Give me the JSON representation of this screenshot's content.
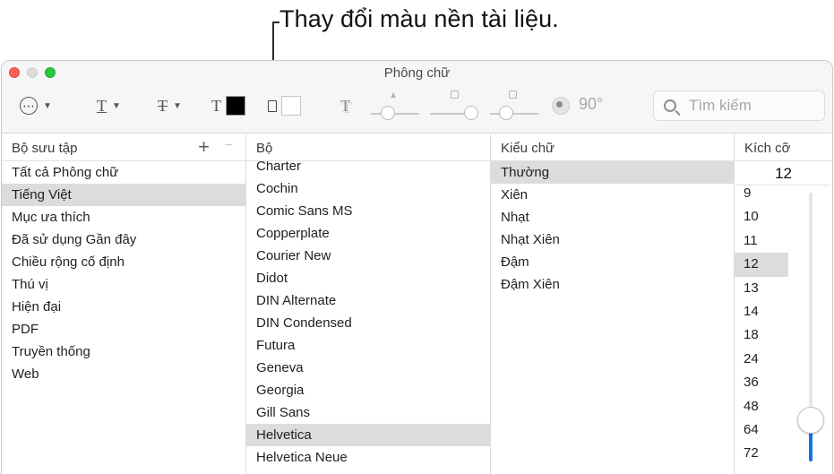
{
  "callout": "Thay đổi màu nền tài liệu.",
  "window": {
    "title": "Phông chữ"
  },
  "toolbar": {
    "action_glyph": "⋯",
    "underline_glyph": "T",
    "strike_glyph": "T",
    "text_color_glyph": "T",
    "shadow_glyph": "T",
    "text_color": "#000000",
    "doc_color": "#ffffff",
    "angle": "90°",
    "search_placeholder": "Tìm kiếm"
  },
  "collections": {
    "header": "Bộ sưu tập",
    "add": "+",
    "remove": "−",
    "items": [
      "Tất cả Phông chữ",
      "Tiếng Việt",
      "Mục ưa thích",
      "Đã sử dụng Gần đây",
      "Chiều rộng cố định",
      "Thú vị",
      "Hiện đại",
      "PDF",
      "Truyền thống",
      "Web"
    ],
    "selected": 1
  },
  "families": {
    "header": "Bộ",
    "items": [
      "Charter",
      "Cochin",
      "Comic Sans MS",
      "Copperplate",
      "Courier New",
      "Didot",
      "DIN Alternate",
      "DIN Condensed",
      "Futura",
      "Geneva",
      "Georgia",
      "Gill Sans",
      "Helvetica",
      "Helvetica Neue"
    ],
    "selected": 12
  },
  "styles": {
    "header": "Kiểu chữ",
    "items": [
      "Thường",
      "Xiên",
      "Nhạt",
      "Nhạt Xiên",
      "Đậm",
      "Đậm Xiên"
    ],
    "selected": 0
  },
  "sizes": {
    "header": "Kích cỡ",
    "value": "12",
    "items": [
      "9",
      "10",
      "11",
      "12",
      "13",
      "14",
      "18",
      "24",
      "36",
      "48",
      "64",
      "72"
    ],
    "selected": 3
  }
}
